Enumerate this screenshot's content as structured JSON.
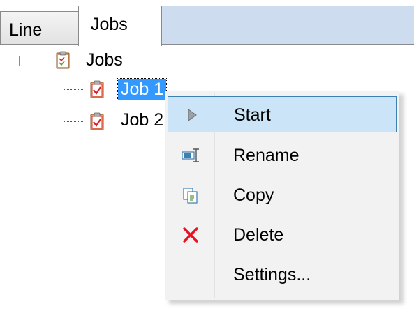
{
  "tabs": [
    {
      "label": "Line",
      "active": false
    },
    {
      "label": "Jobs",
      "active": true
    }
  ],
  "tree": {
    "root": {
      "label": "Jobs",
      "expanded": true,
      "icon": "clipboard-icon"
    },
    "children": [
      {
        "label": "Job 1",
        "selected": true,
        "icon": "clipboard-check-icon"
      },
      {
        "label": "Job 2",
        "selected": false,
        "icon": "clipboard-check-icon"
      }
    ]
  },
  "context_menu": {
    "items": [
      {
        "label": "Start",
        "icon": "play-icon",
        "highlighted": true
      },
      {
        "label": "Rename",
        "icon": "rename-icon",
        "highlighted": false
      },
      {
        "label": "Copy",
        "icon": "copy-icon",
        "highlighted": false
      },
      {
        "label": "Delete",
        "icon": "delete-icon",
        "highlighted": false
      },
      {
        "label": "Settings...",
        "icon": "",
        "highlighted": false
      }
    ]
  },
  "colors": {
    "selection": "#3399ff",
    "menu_highlight": "#cce4f7",
    "menu_highlight_border": "#3c7fb1",
    "tab_strip": "#cdddef",
    "delete_red": "#e81123"
  }
}
